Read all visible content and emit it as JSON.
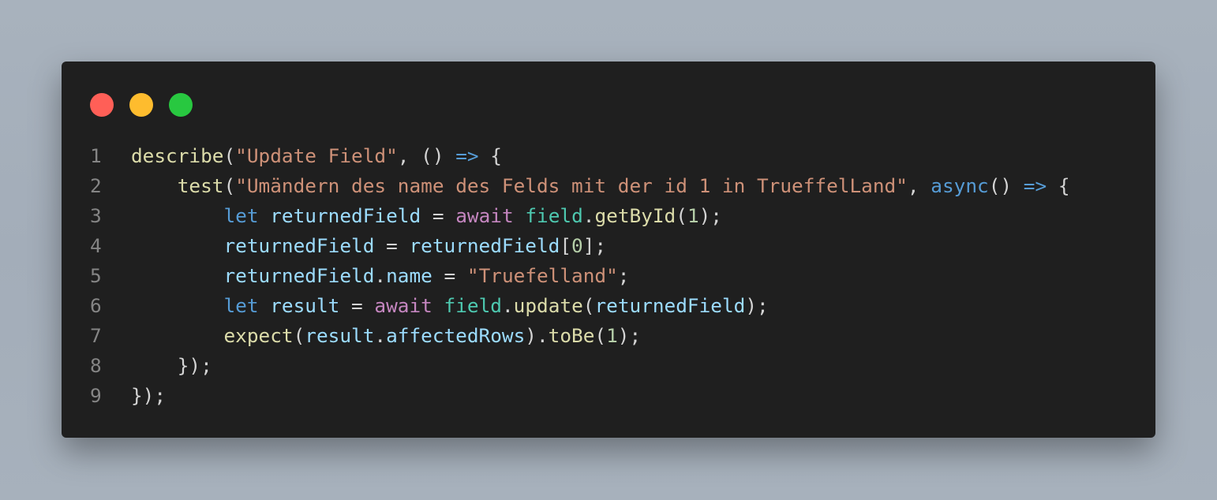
{
  "window": {
    "controls": [
      {
        "name": "close",
        "color": "#ff5f57"
      },
      {
        "name": "minimize",
        "color": "#febc2e"
      },
      {
        "name": "maximize",
        "color": "#28c840"
      }
    ]
  },
  "code": {
    "language": "javascript",
    "colors": {
      "function": "#dcdcaa",
      "string": "#ce9178",
      "keyword": "#569cd6",
      "control": "#c586c0",
      "variable": "#9cdcfe",
      "class": "#4ec9b0",
      "number": "#b5cea8",
      "plain": "#d4d4d4",
      "line_number": "#858585"
    },
    "lines": [
      {
        "number": "1",
        "tokens": [
          {
            "text": "describe",
            "type": "function"
          },
          {
            "text": "(",
            "type": "plain"
          },
          {
            "text": "\"Update Field\"",
            "type": "string"
          },
          {
            "text": ", () ",
            "type": "plain"
          },
          {
            "text": "=>",
            "type": "keyword"
          },
          {
            "text": " {",
            "type": "plain"
          }
        ]
      },
      {
        "number": "2",
        "tokens": [
          {
            "text": "    ",
            "type": "plain"
          },
          {
            "text": "test",
            "type": "function"
          },
          {
            "text": "(",
            "type": "plain"
          },
          {
            "text": "\"Umändern des name des Felds mit der id 1 in TrueffelLand\"",
            "type": "string"
          },
          {
            "text": ", ",
            "type": "plain"
          },
          {
            "text": "async",
            "type": "keyword"
          },
          {
            "text": "() ",
            "type": "plain"
          },
          {
            "text": "=>",
            "type": "keyword"
          },
          {
            "text": " {",
            "type": "plain"
          }
        ]
      },
      {
        "number": "3",
        "tokens": [
          {
            "text": "        ",
            "type": "plain"
          },
          {
            "text": "let",
            "type": "keyword"
          },
          {
            "text": " ",
            "type": "plain"
          },
          {
            "text": "returnedField",
            "type": "variable"
          },
          {
            "text": " = ",
            "type": "plain"
          },
          {
            "text": "await",
            "type": "control"
          },
          {
            "text": " ",
            "type": "plain"
          },
          {
            "text": "field",
            "type": "class"
          },
          {
            "text": ".",
            "type": "plain"
          },
          {
            "text": "getById",
            "type": "function"
          },
          {
            "text": "(",
            "type": "plain"
          },
          {
            "text": "1",
            "type": "number"
          },
          {
            "text": ");",
            "type": "plain"
          }
        ]
      },
      {
        "number": "4",
        "tokens": [
          {
            "text": "        ",
            "type": "plain"
          },
          {
            "text": "returnedField",
            "type": "variable"
          },
          {
            "text": " = ",
            "type": "plain"
          },
          {
            "text": "returnedField",
            "type": "variable"
          },
          {
            "text": "[",
            "type": "plain"
          },
          {
            "text": "0",
            "type": "number"
          },
          {
            "text": "];",
            "type": "plain"
          }
        ]
      },
      {
        "number": "5",
        "tokens": [
          {
            "text": "        ",
            "type": "plain"
          },
          {
            "text": "returnedField",
            "type": "variable"
          },
          {
            "text": ".",
            "type": "plain"
          },
          {
            "text": "name",
            "type": "variable"
          },
          {
            "text": " = ",
            "type": "plain"
          },
          {
            "text": "\"Truefelland\"",
            "type": "string"
          },
          {
            "text": ";",
            "type": "plain"
          }
        ]
      },
      {
        "number": "6",
        "tokens": [
          {
            "text": "        ",
            "type": "plain"
          },
          {
            "text": "let",
            "type": "keyword"
          },
          {
            "text": " ",
            "type": "plain"
          },
          {
            "text": "result",
            "type": "variable"
          },
          {
            "text": " = ",
            "type": "plain"
          },
          {
            "text": "await",
            "type": "control"
          },
          {
            "text": " ",
            "type": "plain"
          },
          {
            "text": "field",
            "type": "class"
          },
          {
            "text": ".",
            "type": "plain"
          },
          {
            "text": "update",
            "type": "function"
          },
          {
            "text": "(",
            "type": "plain"
          },
          {
            "text": "returnedField",
            "type": "variable"
          },
          {
            "text": ");",
            "type": "plain"
          }
        ]
      },
      {
        "number": "7",
        "tokens": [
          {
            "text": "        ",
            "type": "plain"
          },
          {
            "text": "expect",
            "type": "function"
          },
          {
            "text": "(",
            "type": "plain"
          },
          {
            "text": "result",
            "type": "variable"
          },
          {
            "text": ".",
            "type": "plain"
          },
          {
            "text": "affectedRows",
            "type": "variable"
          },
          {
            "text": ").",
            "type": "plain"
          },
          {
            "text": "toBe",
            "type": "function"
          },
          {
            "text": "(",
            "type": "plain"
          },
          {
            "text": "1",
            "type": "number"
          },
          {
            "text": ");",
            "type": "plain"
          }
        ]
      },
      {
        "number": "8",
        "tokens": [
          {
            "text": "    ",
            "type": "plain"
          },
          {
            "text": "});",
            "type": "plain"
          }
        ]
      },
      {
        "number": "9",
        "tokens": [
          {
            "text": "});",
            "type": "plain"
          }
        ]
      }
    ]
  }
}
